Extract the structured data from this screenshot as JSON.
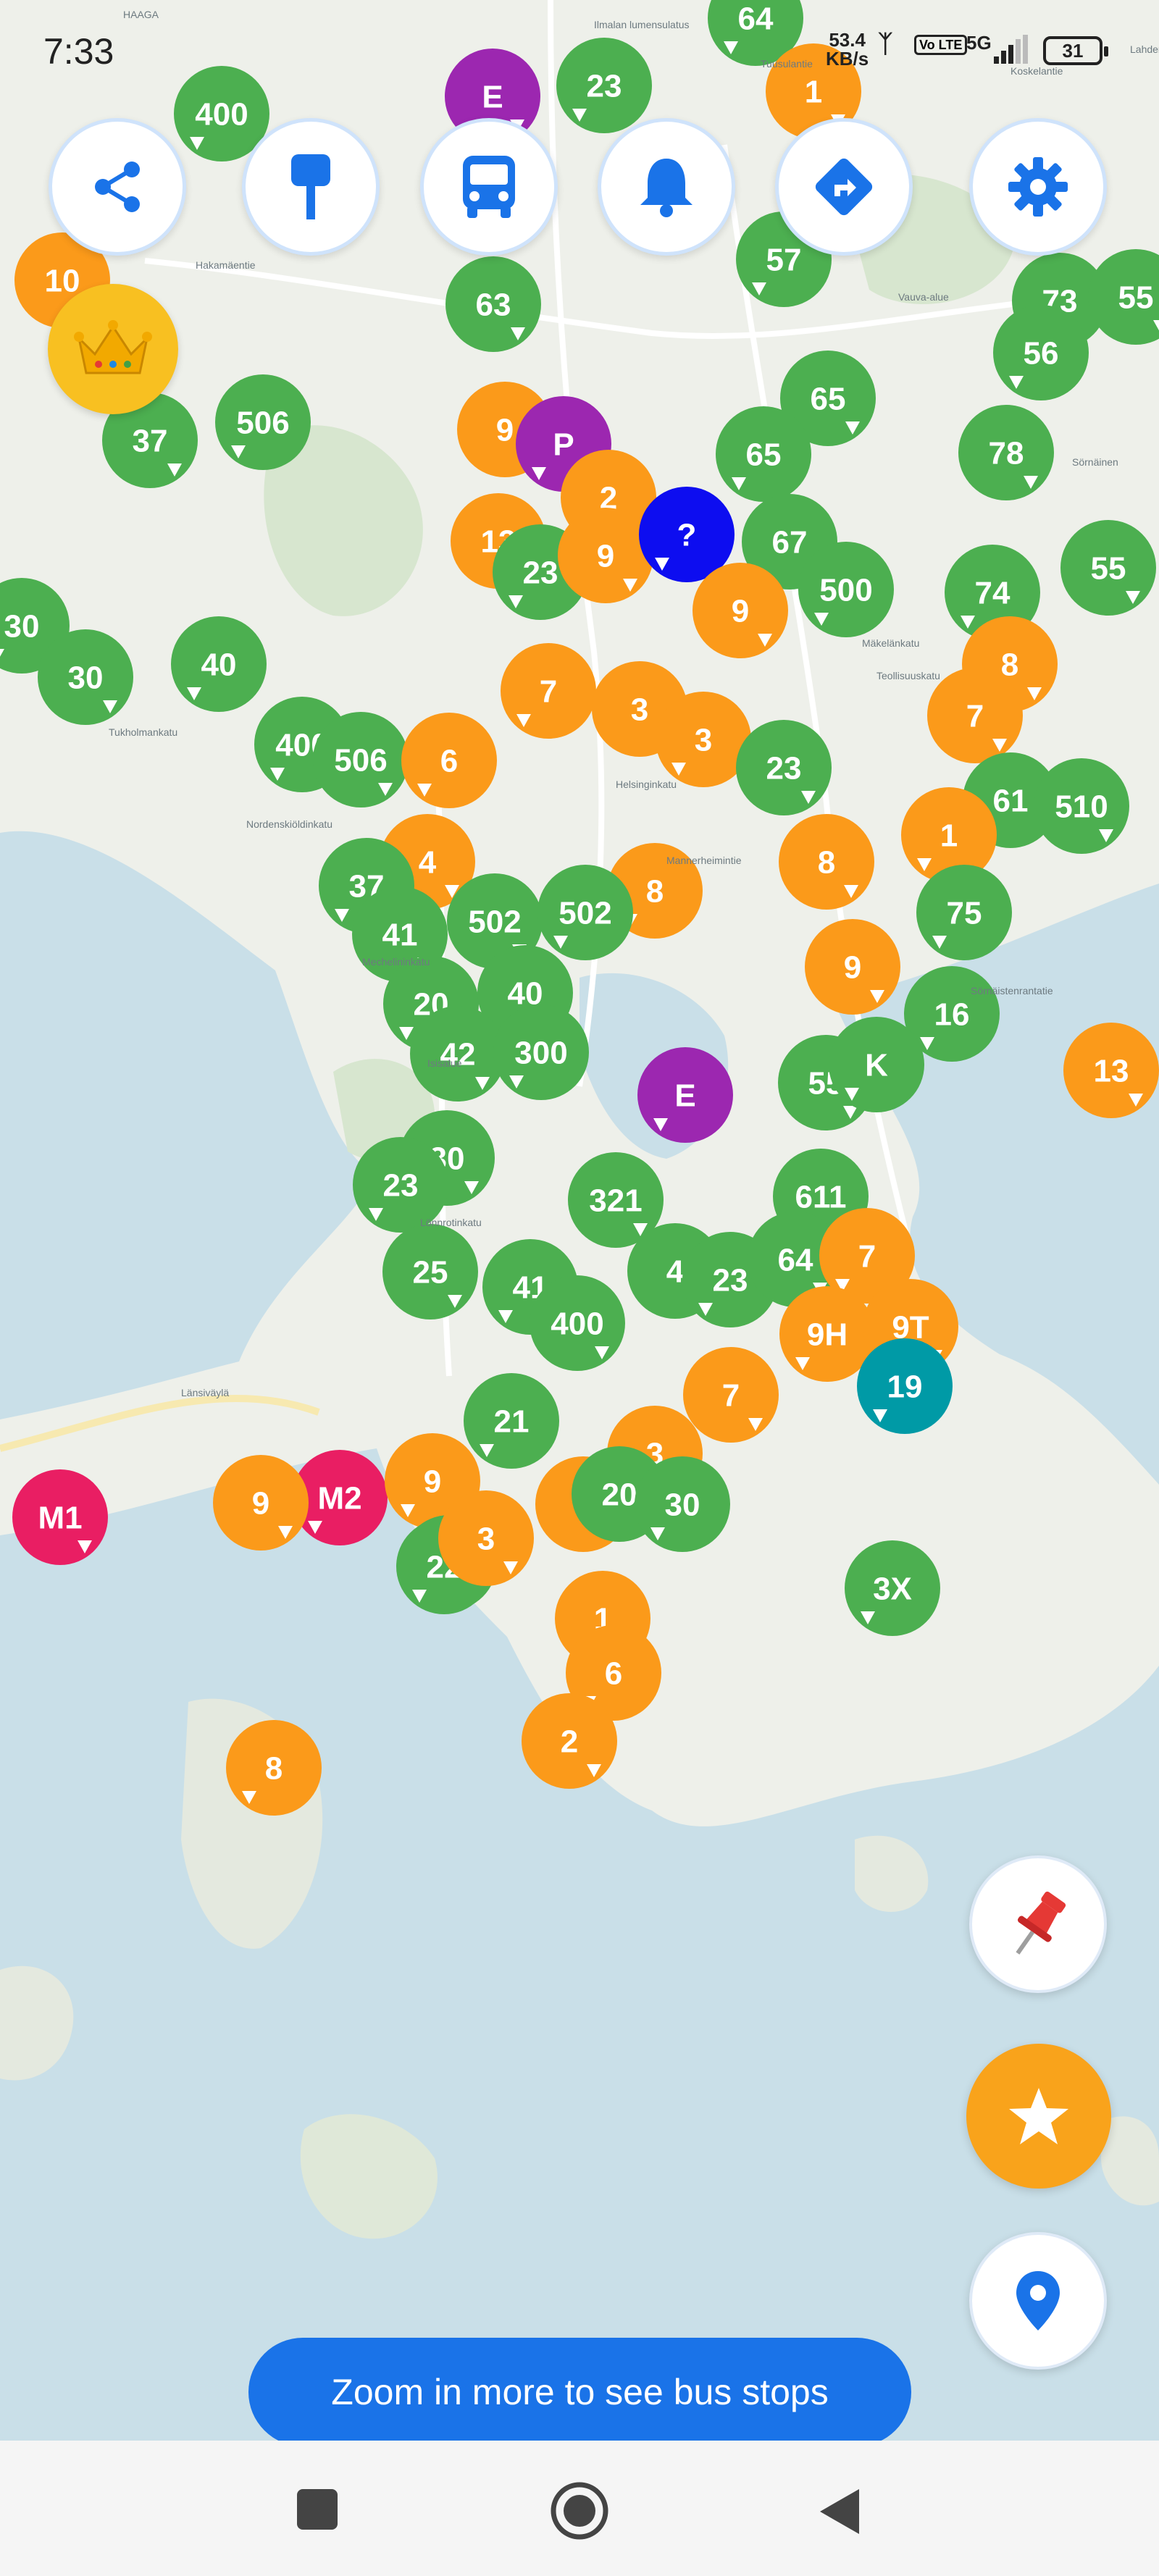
{
  "status_bar": {
    "time": "7:33",
    "net_speed_value": "53.4",
    "net_speed_unit": "KB/s",
    "volte": "Vo LTE",
    "network": "5G",
    "battery": "31"
  },
  "toolbar": {
    "icons": [
      "share-icon",
      "bus-stop-sign-icon",
      "bus-icon",
      "bell-icon",
      "directions-icon",
      "gear-icon"
    ]
  },
  "map": {
    "place_labels": [
      "HAAGA",
      "Ilmalan lumensulatus",
      "Tuusulantie",
      "Koskelantie",
      "Lahdentie",
      "Hakamäentie",
      "Vauva-alue",
      "Sörnäinen",
      "Teollisuuskatu",
      "Mäkelänkatu",
      "Tukholmankatu",
      "Isisalue",
      "Mechelininkatu",
      "Helsinginkatu",
      "Lönnrotinkatu",
      "Länsiväylä",
      "Sörnäistenrantatie",
      "Nordenskiöldinkatu",
      "Mannerheimintie"
    ],
    "markers": [
      {
        "label": "64",
        "color": "green"
      },
      {
        "label": "E",
        "color": "purple"
      },
      {
        "label": "23",
        "color": "green"
      },
      {
        "label": "1",
        "color": "orange"
      },
      {
        "label": "400",
        "color": "green"
      },
      {
        "label": "10",
        "color": "orange"
      },
      {
        "label": "57",
        "color": "green"
      },
      {
        "label": "63",
        "color": "green"
      },
      {
        "label": "73",
        "color": "green"
      },
      {
        "label": "55",
        "color": "green"
      },
      {
        "label": "56",
        "color": "green"
      },
      {
        "label": "37",
        "color": "green"
      },
      {
        "label": "506",
        "color": "green"
      },
      {
        "label": "9",
        "color": "orange"
      },
      {
        "label": "P",
        "color": "purple"
      },
      {
        "label": "65",
        "color": "green"
      },
      {
        "label": "65",
        "color": "green"
      },
      {
        "label": "78",
        "color": "green"
      },
      {
        "label": "2",
        "color": "orange"
      },
      {
        "label": "13",
        "color": "orange"
      },
      {
        "label": "23",
        "color": "green"
      },
      {
        "label": "9",
        "color": "orange"
      },
      {
        "label": "?",
        "color": "blue"
      },
      {
        "label": "67",
        "color": "green"
      },
      {
        "label": "500",
        "color": "green"
      },
      {
        "label": "9",
        "color": "orange"
      },
      {
        "label": "74",
        "color": "green"
      },
      {
        "label": "55",
        "color": "green"
      },
      {
        "label": "30",
        "color": "green"
      },
      {
        "label": "30",
        "color": "green"
      },
      {
        "label": "40",
        "color": "green"
      },
      {
        "label": "8",
        "color": "orange"
      },
      {
        "label": "7",
        "color": "orange"
      },
      {
        "label": "3",
        "color": "orange"
      },
      {
        "label": "3",
        "color": "orange"
      },
      {
        "label": "7",
        "color": "orange"
      },
      {
        "label": "400",
        "color": "green"
      },
      {
        "label": "506",
        "color": "green"
      },
      {
        "label": "6",
        "color": "orange"
      },
      {
        "label": "23",
        "color": "green"
      },
      {
        "label": "61",
        "color": "green"
      },
      {
        "label": "510",
        "color": "green"
      },
      {
        "label": "1",
        "color": "orange"
      },
      {
        "label": "4",
        "color": "orange"
      },
      {
        "label": "37",
        "color": "green"
      },
      {
        "label": "8",
        "color": "orange"
      },
      {
        "label": "8",
        "color": "orange"
      },
      {
        "label": "502",
        "color": "green"
      },
      {
        "label": "502",
        "color": "green"
      },
      {
        "label": "41",
        "color": "green"
      },
      {
        "label": "75",
        "color": "green"
      },
      {
        "label": "9",
        "color": "orange"
      },
      {
        "label": "20",
        "color": "green"
      },
      {
        "label": "40",
        "color": "green"
      },
      {
        "label": "16",
        "color": "green"
      },
      {
        "label": "42",
        "color": "green"
      },
      {
        "label": "300",
        "color": "green"
      },
      {
        "label": "55",
        "color": "green"
      },
      {
        "label": "K",
        "color": "green"
      },
      {
        "label": "13",
        "color": "orange"
      },
      {
        "label": "E",
        "color": "purple"
      },
      {
        "label": "30",
        "color": "green"
      },
      {
        "label": "23",
        "color": "green"
      },
      {
        "label": "321",
        "color": "green"
      },
      {
        "label": "611",
        "color": "green"
      },
      {
        "label": "25",
        "color": "green"
      },
      {
        "label": "41",
        "color": "green"
      },
      {
        "label": "4",
        "color": "green"
      },
      {
        "label": "23",
        "color": "green"
      },
      {
        "label": "64",
        "color": "green"
      },
      {
        "label": "7",
        "color": "orange"
      },
      {
        "label": "400",
        "color": "green"
      },
      {
        "label": "9H",
        "color": "orange"
      },
      {
        "label": "9T",
        "color": "orange"
      },
      {
        "label": "19",
        "color": "teal"
      },
      {
        "label": "7",
        "color": "orange"
      },
      {
        "label": "21",
        "color": "green"
      },
      {
        "label": "4",
        "color": "orange"
      },
      {
        "label": "3",
        "color": "orange"
      },
      {
        "label": "M1",
        "color": "pink"
      },
      {
        "label": "M2",
        "color": "pink"
      },
      {
        "label": "9",
        "color": "orange"
      },
      {
        "label": "9",
        "color": "orange"
      },
      {
        "label": "20",
        "color": "green"
      },
      {
        "label": "30",
        "color": "green"
      },
      {
        "label": "22",
        "color": "green"
      },
      {
        "label": "22",
        "color": "green"
      },
      {
        "label": "3",
        "color": "orange"
      },
      {
        "label": "3X",
        "color": "green"
      },
      {
        "label": "1",
        "color": "orange"
      },
      {
        "label": "6",
        "color": "orange"
      },
      {
        "label": "2",
        "color": "orange"
      },
      {
        "label": "8",
        "color": "orange"
      }
    ]
  },
  "fab": {
    "pin": "pin-icon",
    "favorite": "star-icon",
    "location": "location-icon"
  },
  "banner": {
    "text": "Zoom in more to see bus stops"
  },
  "nav": {
    "items": [
      "recents-icon",
      "home-icon",
      "back-icon"
    ]
  },
  "colors": {
    "green": "#4caf50",
    "orange": "#fb9a1a",
    "purple": "#9c27b0",
    "blue": "#0d0df0",
    "teal": "#009aa6",
    "pink": "#e91e63",
    "accent": "#1a73e8",
    "water": "#c9dfe8",
    "land": "#eef0ea"
  }
}
